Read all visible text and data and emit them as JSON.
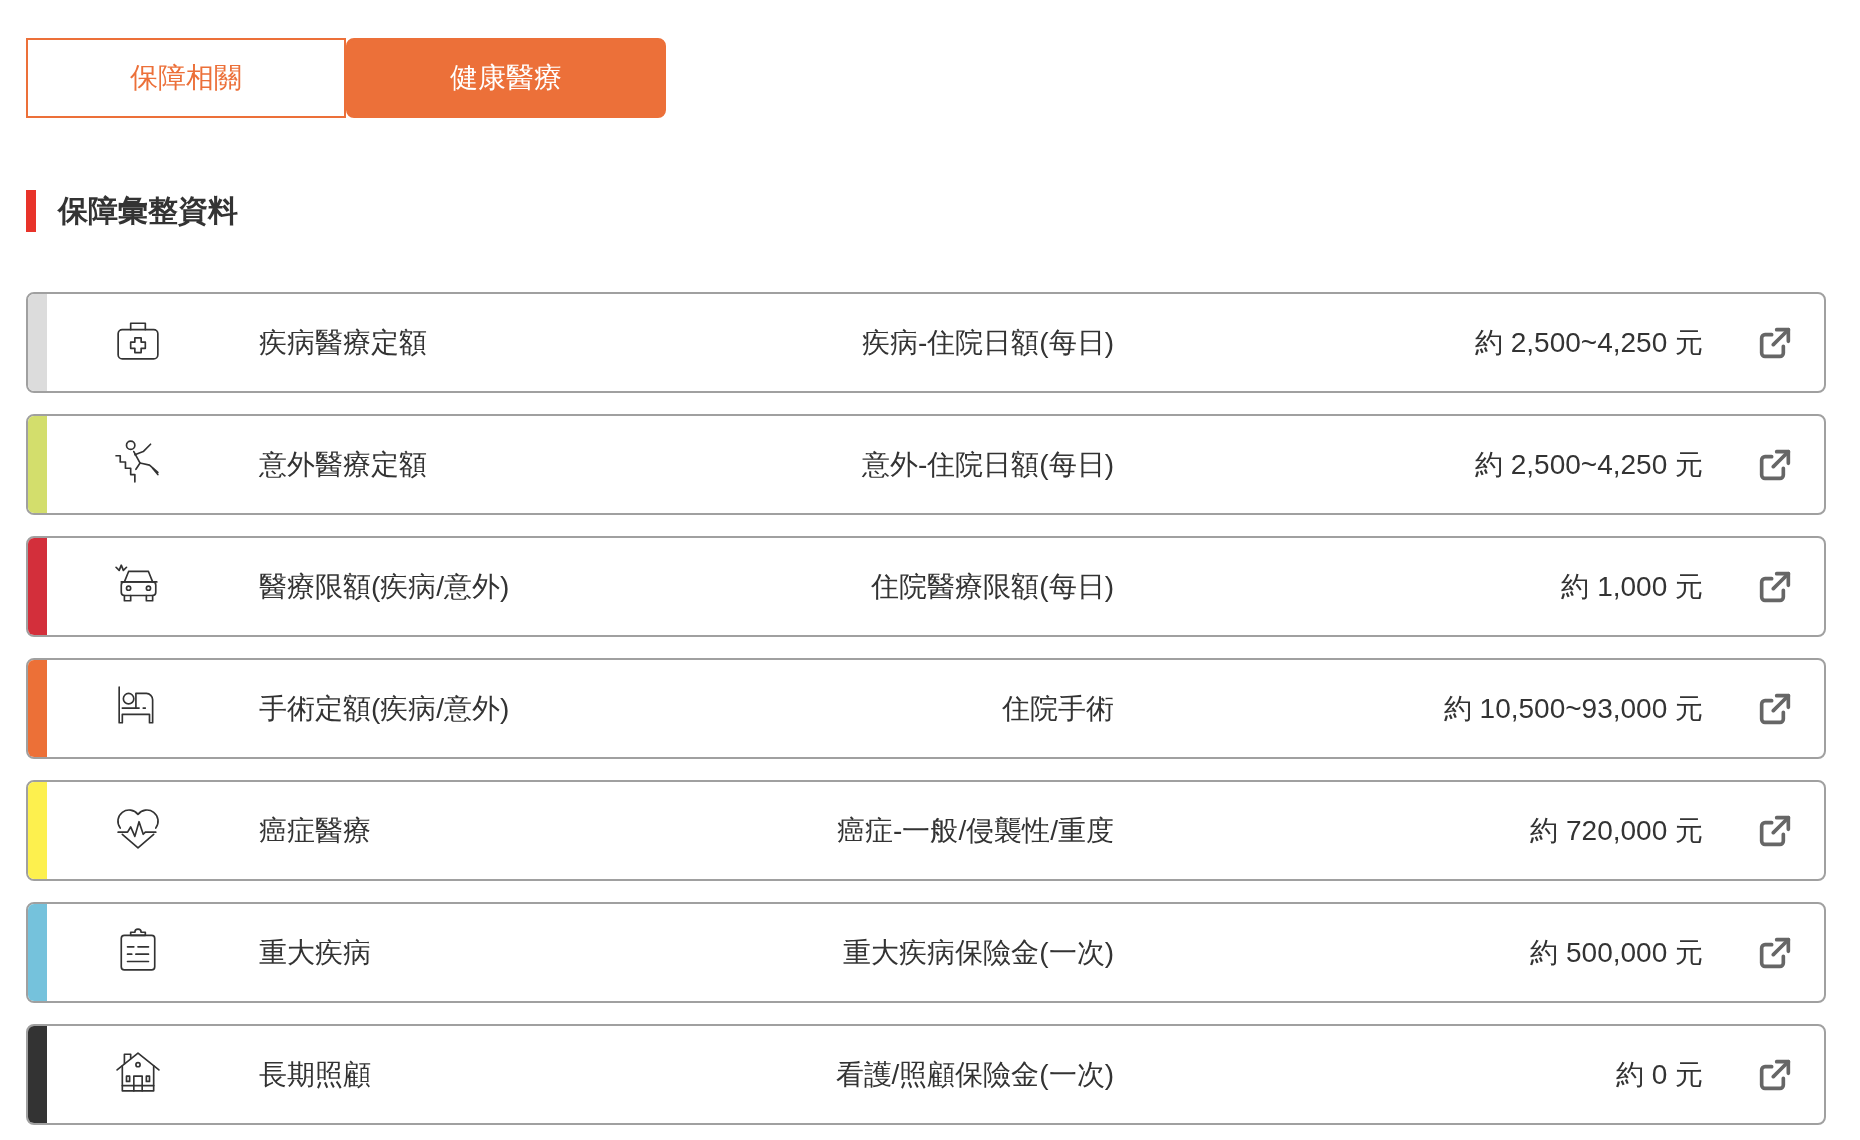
{
  "tabs": [
    {
      "label": "保障相關",
      "selected": false
    },
    {
      "label": "健康醫療",
      "selected": true
    }
  ],
  "section": {
    "title": "保障彙整資料"
  },
  "rows": [
    {
      "name": "疾病醫療定額",
      "item": "疾病-住院日額(每日)",
      "amount": "約 2,500~4,250 元",
      "color": "#dcdcdc"
    },
    {
      "name": "意外醫療定額",
      "item": "意外-住院日額(每日)",
      "amount": "約 2,500~4,250 元",
      "color": "#d3de6c"
    },
    {
      "name": "醫療限額(疾病/意外)",
      "item": "住院醫療限額(每日)",
      "amount": "約 1,000 元",
      "color": "#d32f3b"
    },
    {
      "name": "手術定額(疾病/意外)",
      "item": "住院手術",
      "amount": "約 10,500~93,000 元",
      "color": "#ec7037"
    },
    {
      "name": "癌症醫療",
      "item": "癌症-一般/侵襲性/重度",
      "amount": "約 720,000 元",
      "color": "#fdf04e"
    },
    {
      "name": "重大疾病",
      "item": "重大疾病保險金(一次)",
      "amount": "約 500,000 元",
      "color": "#75c2dc"
    },
    {
      "name": "長期照顧",
      "item": "看護/照顧保險金(一次)",
      "amount": "約 0 元",
      "color": "#333333"
    }
  ]
}
